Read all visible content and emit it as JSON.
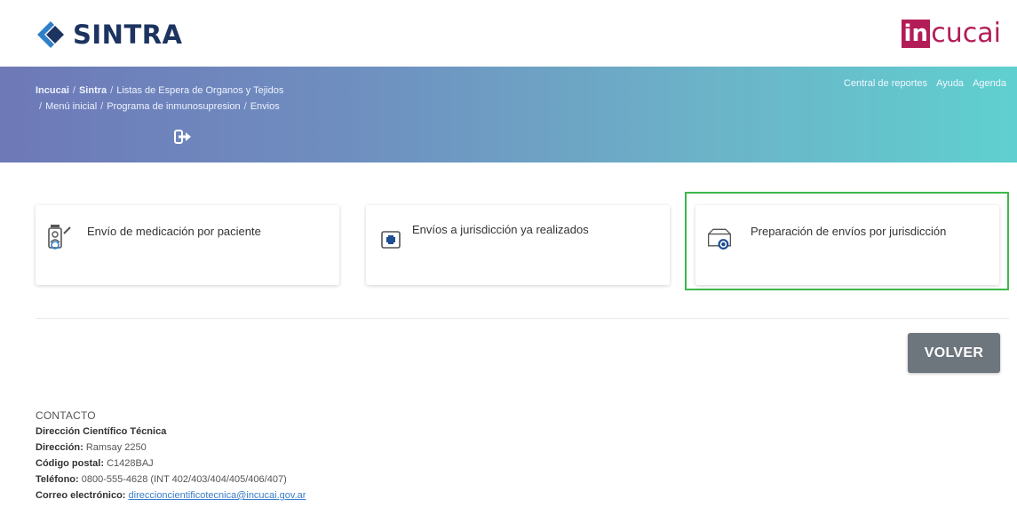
{
  "header": {
    "brand": "SINTRA",
    "partner_mark": "in",
    "partner_rest": "cucai"
  },
  "breadcrumb": {
    "items": [
      "Incucai",
      "Sintra",
      "Listas de Espera de Organos y Tejidos",
      "Menú inicial",
      "Programa de inmunosupresion",
      "Envios"
    ]
  },
  "topnav": {
    "items": [
      "Central de reportes",
      "Ayuda",
      "Agenda"
    ]
  },
  "cards": [
    {
      "label": "Envío de medicación por paciente",
      "icon": "medication-user-icon"
    },
    {
      "label": "Envíos a jurisdicción ya realizados",
      "icon": "medical-box-icon"
    },
    {
      "label": "Preparación de envíos por jurisdicción",
      "icon": "package-search-icon"
    }
  ],
  "actions": {
    "back_label": "VOLVER"
  },
  "footer": {
    "title": "CONTACTO",
    "org": "Dirección Científico Técnica",
    "address_label": "Dirección:",
    "address_value": "Ramsay 2250",
    "postal_label": "Código postal:",
    "postal_value": "C1428BAJ",
    "phone_label": "Teléfono:",
    "phone_value": "0800-555-4628 (INT 402/403/404/405/406/407)",
    "email_label": "Correo electrónico:",
    "email_value": "direccioncientificotecnica@incucai.gov.ar"
  },
  "colors": {
    "brand_navy": "#1d3461",
    "incucai_magenta": "#b31d57",
    "highlight_green": "#3bb84b",
    "button_gray": "#6d757d"
  }
}
